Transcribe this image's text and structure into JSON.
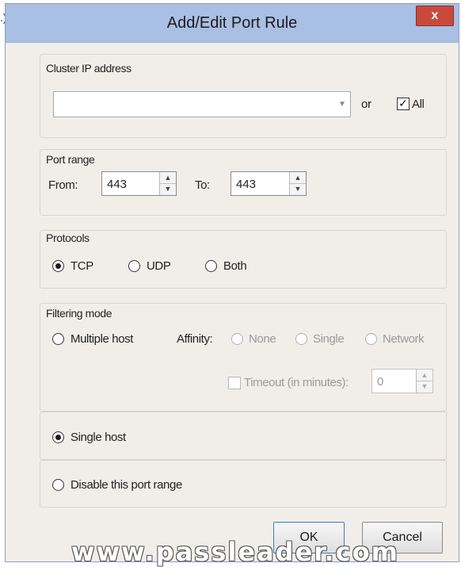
{
  "stray_text": ".)",
  "dialog": {
    "title": "Add/Edit Port Rule",
    "close_glyph": "x"
  },
  "cluster_ip": {
    "label": "Cluster IP address",
    "value": "",
    "or_label": "or",
    "all_label": "All",
    "all_checked": true
  },
  "port_range": {
    "label": "Port range",
    "from_label": "From:",
    "from_value": "443",
    "to_label": "To:",
    "to_value": "443"
  },
  "protocols": {
    "label": "Protocols",
    "options": [
      "TCP",
      "UDP",
      "Both"
    ],
    "selected": "TCP"
  },
  "filtering_mode": {
    "label": "Filtering mode",
    "multiple_host_label": "Multiple host",
    "affinity_label": "Affinity:",
    "affinity_options": [
      "None",
      "Single",
      "Network"
    ],
    "timeout_label": "Timeout (in minutes):",
    "timeout_value": "0",
    "single_host_label": "Single host",
    "disable_label": "Disable this port range",
    "selected": "Single host"
  },
  "buttons": {
    "ok": "OK",
    "cancel": "Cancel"
  },
  "watermark": "www.passleader.com",
  "colors": {
    "titlebar": "#a9bfe3",
    "close_button": "#c94a3c",
    "dialog_bg": "#f1eeea"
  }
}
